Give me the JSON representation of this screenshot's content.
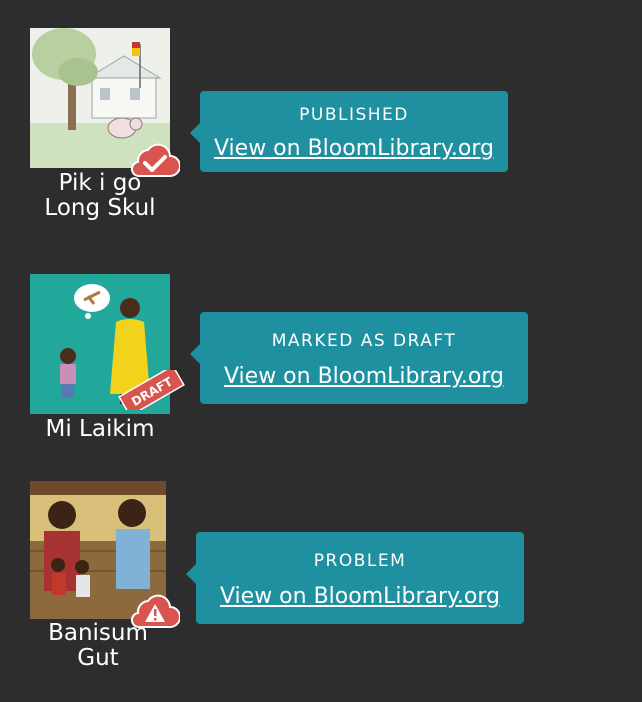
{
  "books": [
    {
      "title_lines": [
        "Pik i go",
        "Long Skul"
      ],
      "badge_icon": "cloud-check-icon",
      "status": "PUBLISHED",
      "link_text": "View on BloomLibrary.org"
    },
    {
      "title_lines": [
        "Mi Laikim"
      ],
      "badge_icon": "draft-ribbon",
      "badge_text": "DRAFT",
      "status": "MARKED AS DRAFT",
      "link_text": "View on BloomLibrary.org"
    },
    {
      "title_lines": [
        "Banisum",
        "Gut"
      ],
      "badge_icon": "cloud-warning-icon",
      "status": "PROBLEM",
      "link_text": "View on BloomLibrary.org"
    }
  ],
  "colors": {
    "background": "#2d2d2d",
    "callout": "#1e90a0",
    "badge_red": "#d9534f"
  }
}
